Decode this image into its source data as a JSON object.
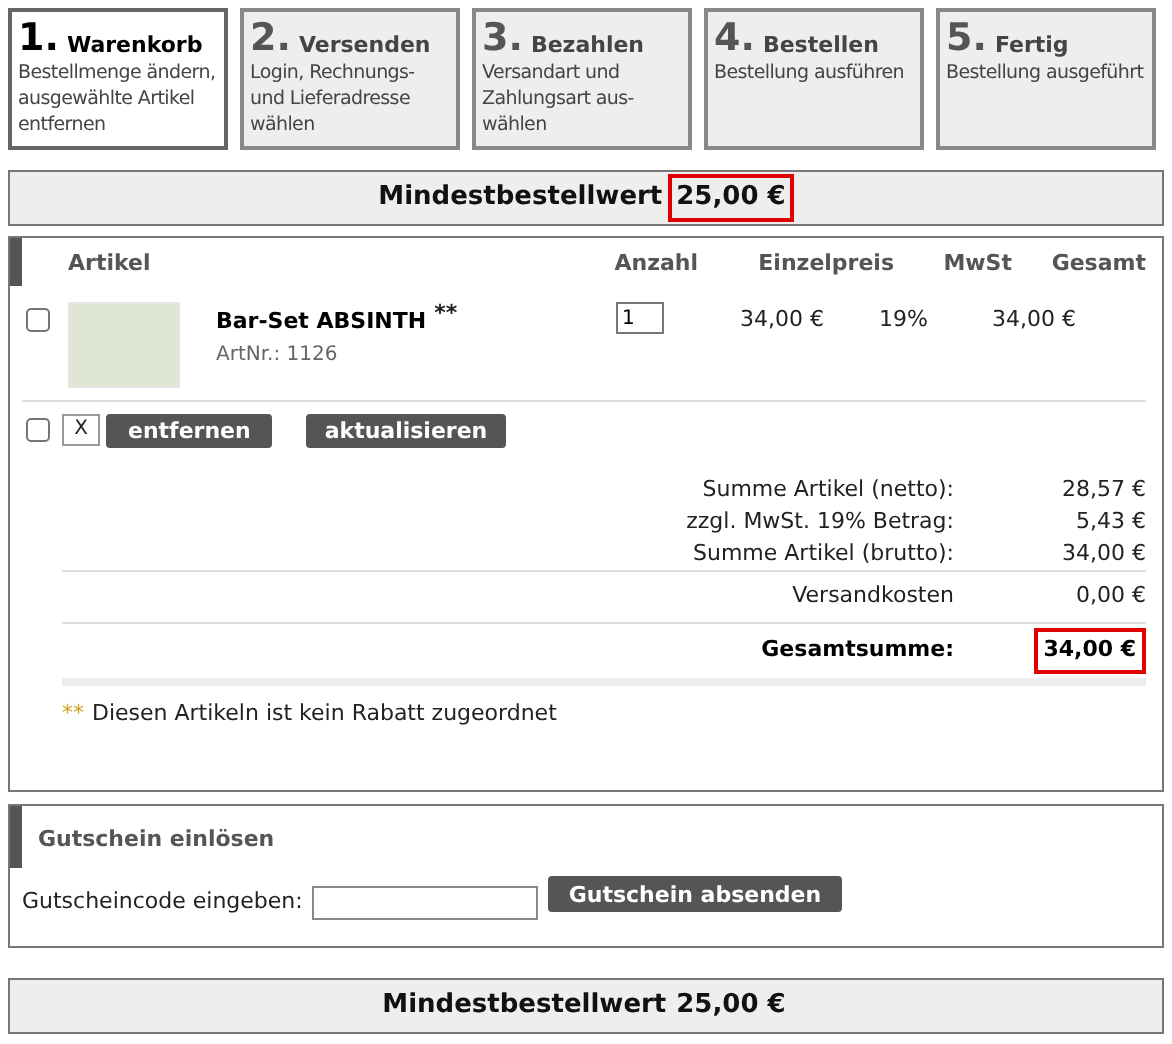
{
  "steps": [
    {
      "number": "1.",
      "title": "Warenkorb",
      "description": "Bestellmenge ändern, ausgewählte Artikel entfernen",
      "selected": true
    },
    {
      "number": "2.",
      "title": "Versenden",
      "description": "Login, Rechnungs- und Lieferadresse wählen",
      "selected": false
    },
    {
      "number": "3.",
      "title": "Bezahlen",
      "description": "Versandart und Zahlungsart aus- wählen",
      "selected": false
    },
    {
      "number": "4.",
      "title": "Bestellen",
      "description": "Bestellung ausführen",
      "selected": false
    },
    {
      "number": "5.",
      "title": "Fertig",
      "description": "Bestellung ausgeführt",
      "selected": false
    }
  ],
  "min_order_top": {
    "label": "Mindestbestellwert",
    "value": "25,00 €",
    "highlighted": true
  },
  "cart": {
    "columns": [
      "Artikel",
      "Anzahl",
      "Einzelpreis",
      "MwSt",
      "Gesamt"
    ],
    "rows": [
      {
        "checked": false,
        "name": "Bar-Set ABSINTH",
        "mark": "**",
        "article_no": "ArtNr.: 1126",
        "quantity": "1",
        "unit_price": "34,00 €",
        "vat": "19%",
        "total": "34,00 €"
      }
    ],
    "select_all_checked": false,
    "clear_button": "X",
    "remove_button": "entfernen",
    "update_button": "aktualisieren",
    "summary": [
      {
        "label": "Summe Artikel (netto):",
        "value": "28,57 €",
        "kind": "plain",
        "highlighted": false
      },
      {
        "label": "zzgl. MwSt. 19% Betrag:",
        "value": "5,43 €",
        "kind": "plain",
        "highlighted": false
      },
      {
        "label": "Summe Artikel (brutto):",
        "value": "34,00 €",
        "kind": "plain",
        "highlighted": false
      },
      {
        "label": "Versandkosten",
        "value": "0,00 €",
        "kind": "separated",
        "highlighted": false
      },
      {
        "label": "Gesamtsumme:",
        "value": "34,00 €",
        "kind": "total",
        "highlighted": true
      }
    ],
    "note_mark": "**",
    "note": "Diesen Artikeln ist kein Rabatt zugeordnet"
  },
  "coupon": {
    "title": "Gutschein einlösen",
    "label": "Gutscheincode eingeben:",
    "button": "Gutschein absenden"
  },
  "min_order_bottom": {
    "label": "Mindestbestellwert",
    "value": "25,00 €",
    "highlighted": false
  }
}
